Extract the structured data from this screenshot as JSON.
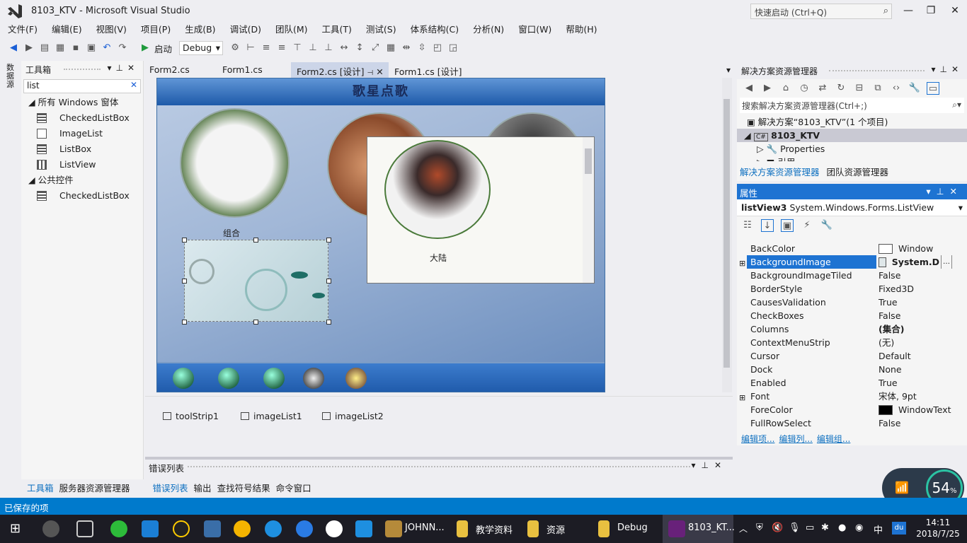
{
  "window": {
    "title": "8103_KTV - Microsoft Visual Studio",
    "quicklaunch_placeholder": "快速启动 (Ctrl+Q)"
  },
  "menu": [
    "文件(F)",
    "编辑(E)",
    "视图(V)",
    "项目(P)",
    "生成(B)",
    "调试(D)",
    "团队(M)",
    "工具(T)",
    "测试(S)",
    "体系结构(C)",
    "分析(N)",
    "窗口(W)",
    "帮助(H)"
  ],
  "toolbar": {
    "start_label": "启动",
    "config": "Debug"
  },
  "left_strip_label": "数据源",
  "toolbox": {
    "title": "工具箱",
    "search": "list",
    "groups": [
      {
        "name": "所有 Windows 窗体",
        "items": [
          "CheckedListBox",
          "ImageList",
          "ListBox",
          "ListView"
        ]
      },
      {
        "name": "公共控件",
        "items": [
          "CheckedListBox"
        ]
      }
    ]
  },
  "doc_tabs": [
    "Form2.cs",
    "Form1.cs",
    "Form2.cs [设计]",
    "Form1.cs [设计]"
  ],
  "form": {
    "title": "歌星点歌",
    "group_label": "组合",
    "popup_label": "大陆"
  },
  "tray": [
    "toolStrip1",
    "imageList1",
    "imageList2"
  ],
  "error_list": {
    "title": "错误列表"
  },
  "bottom_tabs_left": [
    "工具箱",
    "服务器资源管理器"
  ],
  "bottom_tabs": [
    "错误列表",
    "输出",
    "查找符号结果",
    "命令窗口"
  ],
  "solution": {
    "title": "解决方案资源管理器",
    "search": "搜索解决方案资源管理器(Ctrl+;)",
    "tree": [
      "解决方案“8103_KTV”(1 个项目)",
      "8103_KTV",
      "Properties",
      "引用"
    ],
    "tabs": [
      "解决方案资源管理器",
      "团队资源管理器"
    ]
  },
  "properties": {
    "title": "属性",
    "object": "listView3",
    "type": "System.Windows.Forms.ListView",
    "rows": [
      {
        "name": "BackColor",
        "value": "Window"
      },
      {
        "name": "BackgroundImage",
        "value": "System.D"
      },
      {
        "name": "BackgroundImageTiled",
        "value": "False"
      },
      {
        "name": "BorderStyle",
        "value": "Fixed3D"
      },
      {
        "name": "CausesValidation",
        "value": "True"
      },
      {
        "name": "CheckBoxes",
        "value": "False"
      },
      {
        "name": "Columns",
        "value": "(集合)"
      },
      {
        "name": "ContextMenuStrip",
        "value": "(无)"
      },
      {
        "name": "Cursor",
        "value": "Default"
      },
      {
        "name": "Dock",
        "value": "None"
      },
      {
        "name": "Enabled",
        "value": "True"
      },
      {
        "name": "Font",
        "value": "宋体, 9pt"
      },
      {
        "name": "ForeColor",
        "value": "WindowText"
      },
      {
        "name": "FullRowSelect",
        "value": "False"
      }
    ],
    "links": [
      "编辑项...",
      "编辑列...",
      "编辑组..."
    ]
  },
  "status": "已保存的项",
  "network_percent": "54",
  "network_unit": "%",
  "taskbar": {
    "items": [
      "JOHNN...",
      "教学资料",
      "资源",
      "Debug",
      "8103_KT..."
    ],
    "time": "14:11",
    "date": "2018/7/25",
    "ime": "中"
  }
}
